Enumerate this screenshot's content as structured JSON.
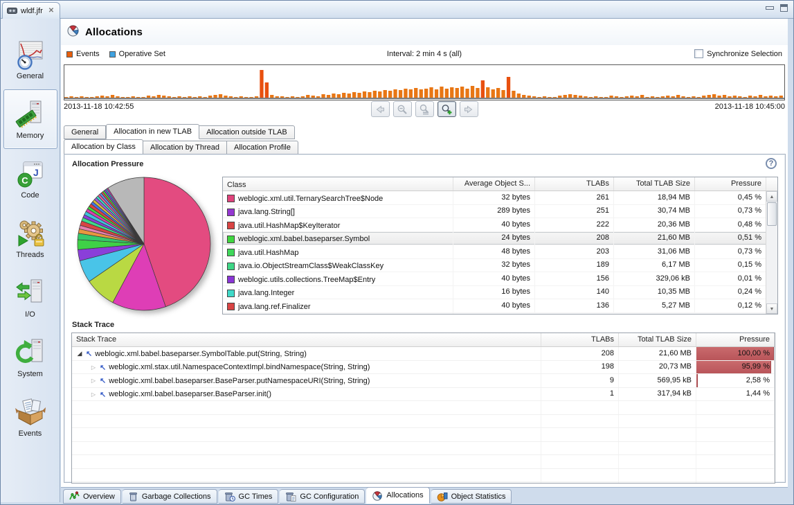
{
  "window": {
    "editor_tab": "wldf.jfr",
    "controls": {
      "minimize": "minimize",
      "maximize": "maximize"
    }
  },
  "sidebar": {
    "items": [
      {
        "label": "General",
        "icon": "general-icon",
        "selected": false
      },
      {
        "label": "Memory",
        "icon": "memory-icon",
        "selected": true
      },
      {
        "label": "Code",
        "icon": "code-icon",
        "selected": false
      },
      {
        "label": "Threads",
        "icon": "threads-icon",
        "selected": false
      },
      {
        "label": "I/O",
        "icon": "io-icon",
        "selected": false
      },
      {
        "label": "System",
        "icon": "system-icon",
        "selected": false
      },
      {
        "label": "Events",
        "icon": "events-icon",
        "selected": false
      }
    ]
  },
  "header": {
    "title": "Allocations",
    "icon": "allocations-pie-icon"
  },
  "timeline": {
    "legend": [
      {
        "label": "Events",
        "color": "#e85f0d"
      },
      {
        "label": "Operative Set",
        "color": "#3fa2e0"
      }
    ],
    "interval_label": "Interval: 2 min 4 s (all)",
    "sync_checkbox_label": "Synchronize Selection",
    "sync_checked": false,
    "start_time": "2013-11-18 10:42:55",
    "end_time": "2013-11-18 10:45:00",
    "nav_buttons": [
      {
        "name": "back",
        "icon": "arrow-left-icon",
        "enabled": false
      },
      {
        "name": "zoom-out",
        "icon": "zoom-out-icon",
        "enabled": false
      },
      {
        "name": "reset-zoom",
        "icon": "zoom-reset-icon",
        "enabled": false
      },
      {
        "name": "zoom-in",
        "icon": "zoom-in-icon",
        "enabled": true
      },
      {
        "name": "forward",
        "icon": "arrow-right-icon",
        "enabled": false
      }
    ]
  },
  "tabs_row1": [
    {
      "label": "General",
      "selected": false
    },
    {
      "label": "Allocation in new TLAB",
      "selected": true
    },
    {
      "label": "Allocation outside TLAB",
      "selected": false
    }
  ],
  "tabs_row2": [
    {
      "label": "Allocation by Class",
      "selected": true
    },
    {
      "label": "Allocation by Thread",
      "selected": false
    },
    {
      "label": "Allocation Profile",
      "selected": false
    }
  ],
  "allocation_pressure": {
    "title": "Allocation Pressure",
    "class_table": {
      "columns": [
        "Class",
        "Average Object S...",
        "TLABs",
        "Total TLAB Size",
        "Pressure"
      ],
      "rows": [
        {
          "color": "#e0447c",
          "class": "weblogic.xml.util.TernarySearchTree$Node",
          "avg": "32 bytes",
          "tlabs": "261",
          "size": "18,94 MB",
          "pressure": "0,45 %",
          "selected": false
        },
        {
          "color": "#9437d1",
          "class": "java.lang.String[]",
          "avg": "289 bytes",
          "tlabs": "251",
          "size": "30,74 MB",
          "pressure": "0,73 %",
          "selected": false
        },
        {
          "color": "#d94444",
          "class": "java.util.HashMap$KeyIterator",
          "avg": "40 bytes",
          "tlabs": "222",
          "size": "20,36 MB",
          "pressure": "0,48 %",
          "selected": false
        },
        {
          "color": "#3fd73f",
          "class": "weblogic.xml.babel.baseparser.Symbol",
          "avg": "24 bytes",
          "tlabs": "208",
          "size": "21,60 MB",
          "pressure": "0,51 %",
          "selected": true
        },
        {
          "color": "#3fd75a",
          "class": "java.util.HashMap",
          "avg": "48 bytes",
          "tlabs": "203",
          "size": "31,06 MB",
          "pressure": "0,73 %",
          "selected": false
        },
        {
          "color": "#3fd787",
          "class": "java.io.ObjectStreamClass$WeakClassKey",
          "avg": "32 bytes",
          "tlabs": "189",
          "size": "6,17 MB",
          "pressure": "0,15 %",
          "selected": false
        },
        {
          "color": "#8a35d6",
          "class": "weblogic.utils.collections.TreeMap$Entry",
          "avg": "40 bytes",
          "tlabs": "156",
          "size": "329,06 kB",
          "pressure": "0,01 %",
          "selected": false
        },
        {
          "color": "#3fd9c8",
          "class": "java.lang.Integer",
          "avg": "16 bytes",
          "tlabs": "140",
          "size": "10,35 MB",
          "pressure": "0,24 %",
          "selected": false
        },
        {
          "color": "#d94444",
          "class": "java.lang.ref.Finalizer",
          "avg": "40 bytes",
          "tlabs": "136",
          "size": "5,27 MB",
          "pressure": "0,12 %",
          "selected": false
        }
      ],
      "partial_row_color": "#3f8fd9"
    }
  },
  "stack_trace": {
    "title": "Stack Trace",
    "table": {
      "columns": [
        "Stack Trace",
        "TLABs",
        "Total TLAB Size",
        "Pressure"
      ],
      "rows": [
        {
          "expanded": true,
          "level": 0,
          "method": "weblogic.xml.babel.baseparser.SymbolTable.put(String, String)",
          "tlabs": "208",
          "size": "21,60 MB",
          "pressure": "100,00 %",
          "bar": 100
        },
        {
          "expanded": false,
          "level": 1,
          "method": "weblogic.xml.stax.util.NamespaceContextImpl.bindNamespace(String, String)",
          "tlabs": "198",
          "size": "20,73 MB",
          "pressure": "95,99 %",
          "bar": 96
        },
        {
          "expanded": false,
          "level": 1,
          "method": "weblogic.xml.babel.baseparser.BaseParser.putNamespaceURI(String, String)",
          "tlabs": "9",
          "size": "569,95 kB",
          "pressure": "2,58 %",
          "bar": 2.2
        },
        {
          "expanded": false,
          "level": 1,
          "method": "weblogic.xml.babel.baseparser.BaseParser.init()",
          "tlabs": "1",
          "size": "317,94 kB",
          "pressure": "1,44 %",
          "bar": 0
        }
      ]
    }
  },
  "bottom_tabs": [
    {
      "label": "Overview",
      "icon": "overview-icon",
      "selected": false
    },
    {
      "label": "Garbage Collections",
      "icon": "trash-icon",
      "selected": false
    },
    {
      "label": "GC Times",
      "icon": "trash-clock-icon",
      "selected": false
    },
    {
      "label": "GC Configuration",
      "icon": "trash-config-icon",
      "selected": false
    },
    {
      "label": "Allocations",
      "icon": "pie-icon",
      "selected": true
    },
    {
      "label": "Object Statistics",
      "icon": "object-stats-icon",
      "selected": false
    }
  ],
  "chart_data": [
    {
      "type": "bar",
      "title": "events-timeline",
      "xlabel": "time",
      "x_start": "2013-11-18 10:42:55",
      "x_end": "2013-11-18 10:45:00",
      "ylim": [
        0,
        44
      ],
      "bar_color": "#e87614",
      "spike_color": "#e8500f",
      "values": [
        1,
        2,
        1,
        2,
        1,
        1,
        2,
        3,
        2,
        4,
        2,
        1,
        1,
        2,
        1,
        1,
        3,
        2,
        4,
        3,
        2,
        1,
        2,
        1,
        2,
        1,
        2,
        1,
        3,
        4,
        5,
        3,
        2,
        1,
        2,
        1,
        1,
        2,
        40,
        22,
        4,
        2,
        2,
        1,
        2,
        1,
        2,
        4,
        3,
        2,
        5,
        4,
        6,
        5,
        7,
        6,
        8,
        7,
        9,
        8,
        10,
        9,
        11,
        10,
        12,
        11,
        13,
        12,
        14,
        12,
        13,
        15,
        12,
        16,
        13,
        15,
        14,
        16,
        13,
        17,
        14,
        25,
        15,
        12,
        14,
        11,
        30,
        10,
        6,
        4,
        3,
        2,
        1,
        2,
        1,
        1,
        3,
        4,
        5,
        4,
        3,
        2,
        1,
        2,
        1,
        1,
        3,
        2,
        1,
        2,
        3,
        2,
        4,
        1,
        2,
        1,
        2,
        3,
        2,
        4,
        2,
        1,
        2,
        1,
        3,
        4,
        5,
        3,
        4,
        2,
        3,
        2,
        1,
        3,
        2,
        4,
        2,
        3,
        2,
        3
      ]
    },
    {
      "type": "pie",
      "title": "allocation-by-class",
      "slices": [
        {
          "value": 41,
          "color": "#e34b80"
        },
        {
          "value": 12,
          "color": "#de3eb6"
        },
        {
          "value": 7,
          "color": "#b9d943"
        },
        {
          "value": 5,
          "color": "#49c4e8"
        },
        {
          "value": 2.5,
          "color": "#8a3fd9"
        },
        {
          "value": 2.2,
          "color": "#3fd147"
        },
        {
          "value": 1.4,
          "color": "#35c96a"
        },
        {
          "value": 1.0,
          "color": "#e8973f"
        },
        {
          "value": 0.8,
          "color": "#e87fb0"
        },
        {
          "value": 1.0,
          "color": "#d94444"
        },
        {
          "value": 0.8,
          "color": "#3fd98a"
        },
        {
          "value": 0.7,
          "color": "#8a3fd9"
        },
        {
          "value": 0.8,
          "color": "#3fc0d9"
        },
        {
          "value": 0.7,
          "color": "#d93fb0"
        },
        {
          "value": 0.6,
          "color": "#44d944"
        },
        {
          "value": 0.7,
          "color": "#d94444"
        },
        {
          "value": 0.6,
          "color": "#4573e8"
        },
        {
          "value": 0.6,
          "color": "#d9b93f"
        },
        {
          "value": 0.6,
          "color": "#9a5fd9"
        },
        {
          "value": 0.5,
          "color": "#3fd9c8"
        },
        {
          "value": 0.5,
          "color": "#e8609f"
        },
        {
          "value": 0.5,
          "color": "#5f8fe8"
        },
        {
          "value": 0.4,
          "color": "#e05050"
        },
        {
          "value": 0.4,
          "color": "#44d944"
        },
        {
          "value": 0.4,
          "color": "#8a3fd9"
        },
        {
          "value": 0.3,
          "color": "#3fc0d9"
        },
        {
          "value": 0.3,
          "color": "#d93fb0"
        },
        {
          "value": 8.4,
          "color": "#b8b8b8"
        }
      ]
    }
  ]
}
